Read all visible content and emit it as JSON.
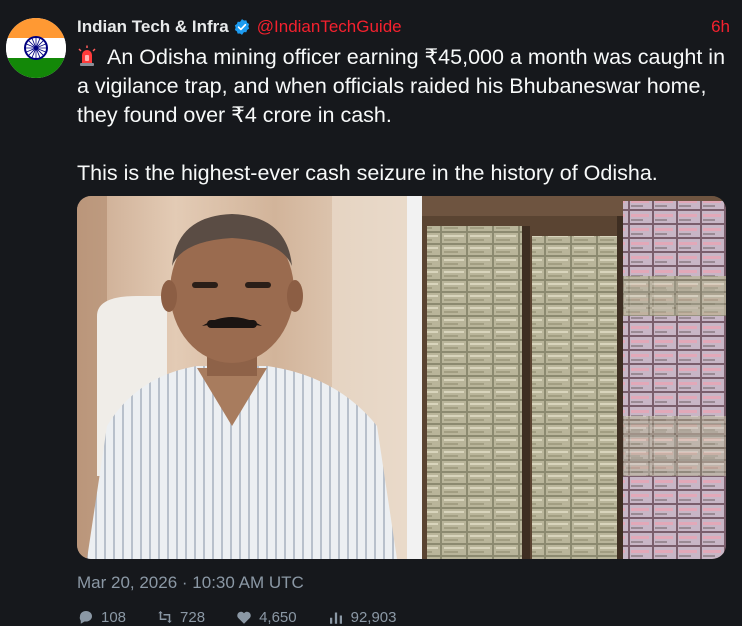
{
  "post": {
    "author_name": "Indian Tech & Infra",
    "handle": "@IndianTechGuide",
    "time": "6h",
    "text_line_1": "An Odisha mining officer earning ₹45,000 a month was caught in a vigilance trap, and when officials raided his Bhubaneswar home, they found over ₹4 crore in cash.",
    "text_line_2": "This is the highest-ever cash seizure in the history of Odisha.",
    "timestamp": "Mar 20, 2026 · 10:30 AM UTC",
    "stats": {
      "replies": "108",
      "reposts": "728",
      "likes": "4,650",
      "views": "92,903"
    }
  },
  "colors": {
    "background": "#16181c",
    "accent": "#f4212e",
    "verified": "#1d9bf0",
    "muted": "#8b98a5"
  },
  "icons": [
    "india-flag-avatar",
    "verified-badge-icon",
    "siren-icon",
    "reply-icon",
    "repost-icon",
    "like-icon",
    "views-icon"
  ]
}
